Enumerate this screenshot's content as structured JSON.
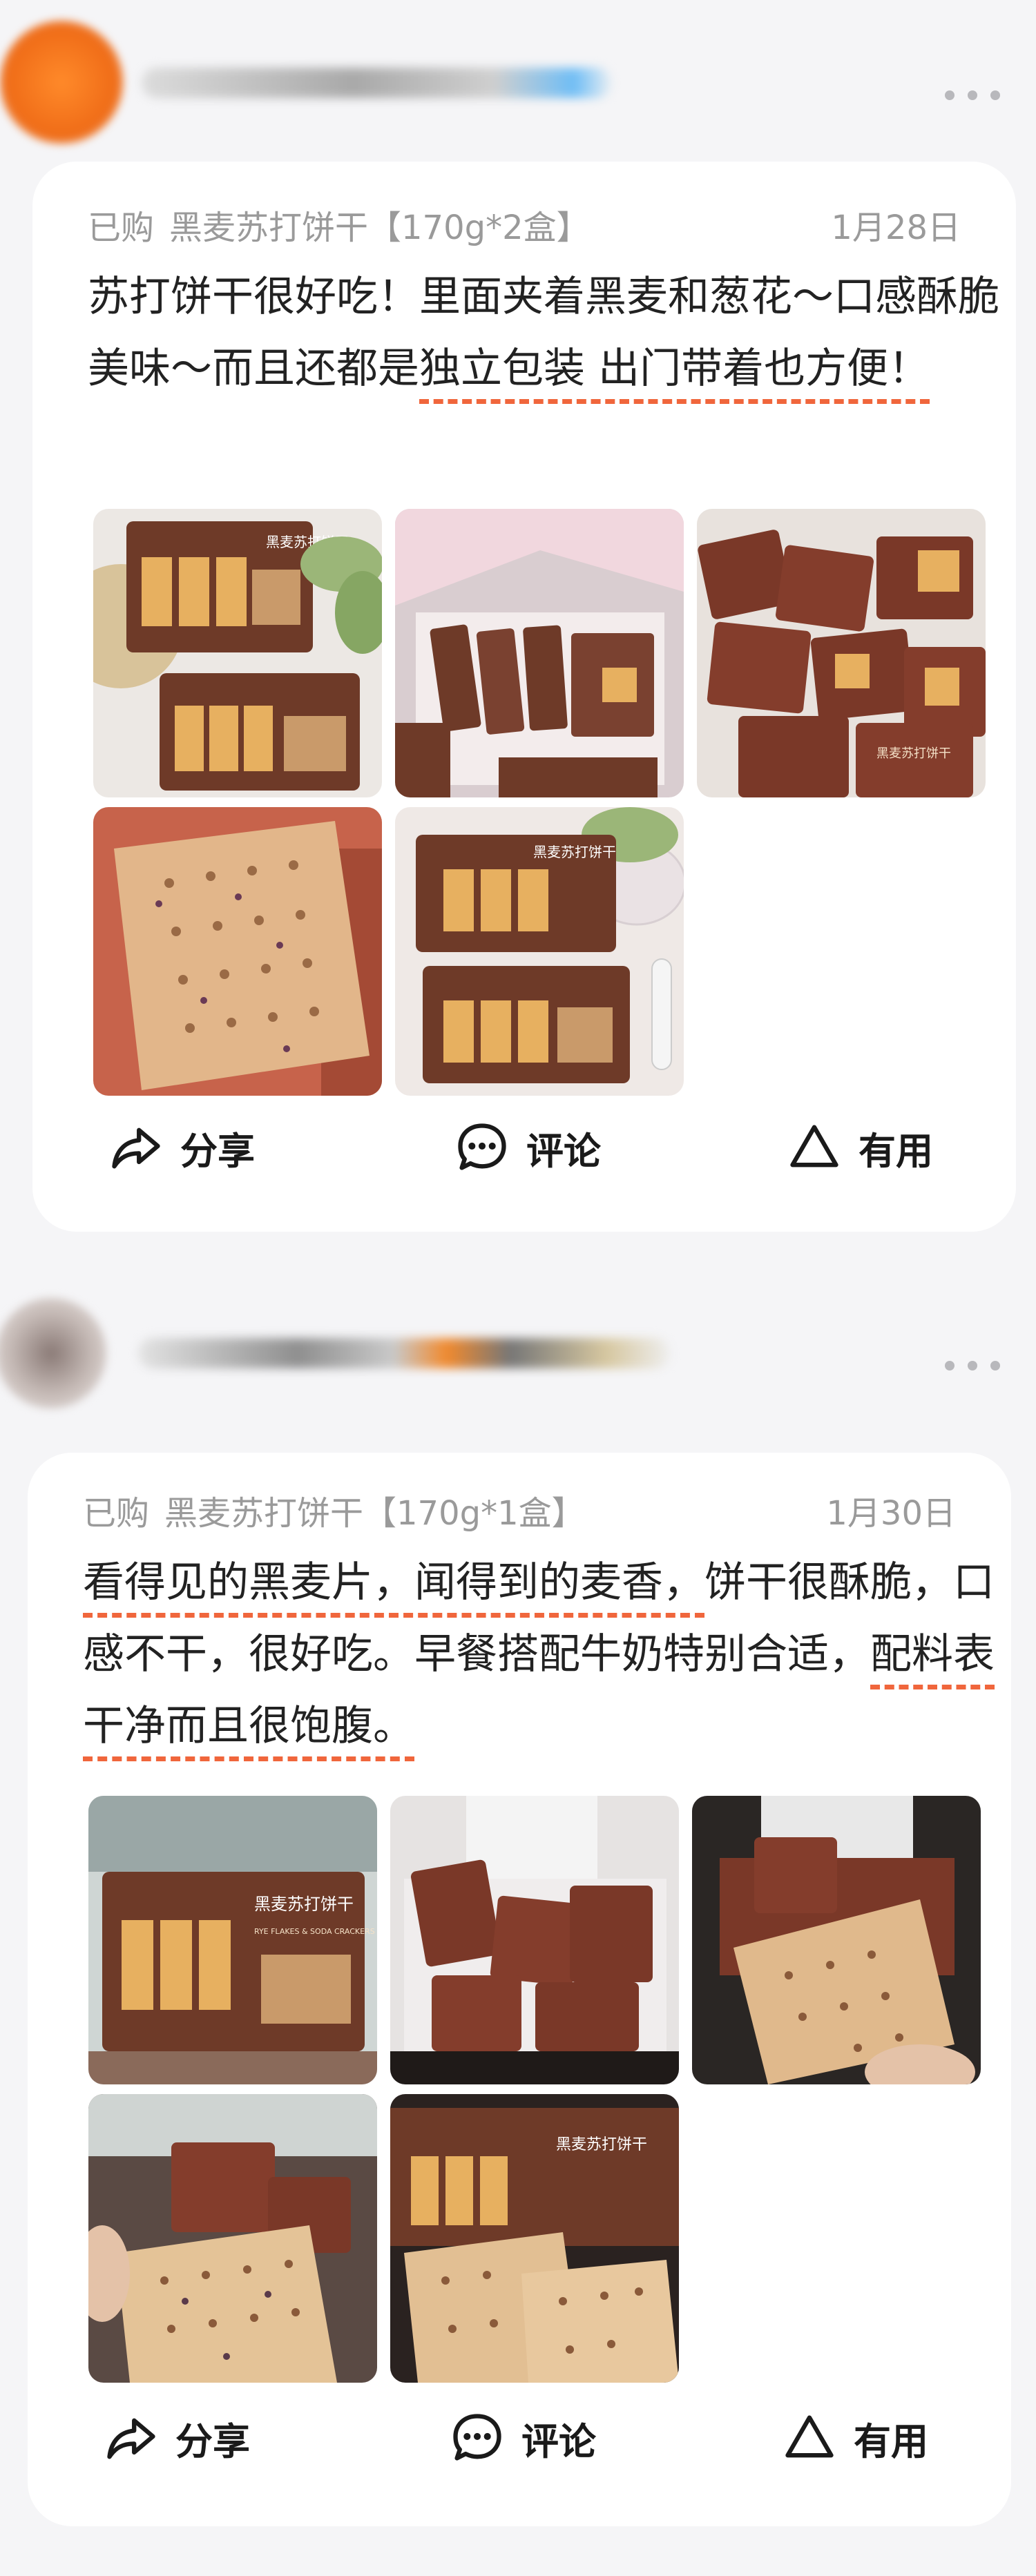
{
  "reviews": [
    {
      "purchase_label": "已购",
      "product": "黑麦苏打饼干【170g*2盒】",
      "date": "1月28日",
      "text_segments": [
        "苏打饼干很好吃！里面夹着黑麦和葱花～口感酥脆美味～而且还都是",
        "独立包装 出门带着也方便！"
      ],
      "photos": [
        {
          "kind": "product-box",
          "box_label": "黑麦苏打饼干"
        },
        {
          "kind": "open-box"
        },
        {
          "kind": "packets",
          "pack_label": "黑麦苏打饼干"
        },
        {
          "kind": "cracker"
        },
        {
          "kind": "product-box",
          "box_label": "黑麦苏打饼干"
        }
      ]
    },
    {
      "purchase_label": "已购",
      "product": "黑麦苏打饼干【170g*1盒】",
      "date": "1月30日",
      "text_segments": [
        "看得见的黑麦片，闻得到的麦香，",
        "饼干很酥脆，口感不干，很好吃。早餐搭配牛奶特别合适，",
        "配料表干净而且很饱腹。"
      ],
      "photos": [
        {
          "kind": "product-box",
          "box_label": "黑麦苏打饼干",
          "box_sublabel": "RYE FLAKES & SODA CRACKERS"
        },
        {
          "kind": "open-box"
        },
        {
          "kind": "cracker-hand"
        },
        {
          "kind": "cracker-hand"
        },
        {
          "kind": "product-box",
          "box_label": "黑麦苏打饼干"
        }
      ]
    }
  ],
  "actions": {
    "share": "分享",
    "comment": "评论",
    "useful": "有用"
  },
  "icons": {
    "share": "share-icon",
    "comment": "comment-icon",
    "useful": "triangle-icon",
    "more": "more-dots-icon"
  },
  "colors": {
    "highlight": "#f0663c",
    "meta": "#9a9a9a",
    "text": "#222222",
    "box": "#6e3a28",
    "cracker": "#e7b060"
  }
}
